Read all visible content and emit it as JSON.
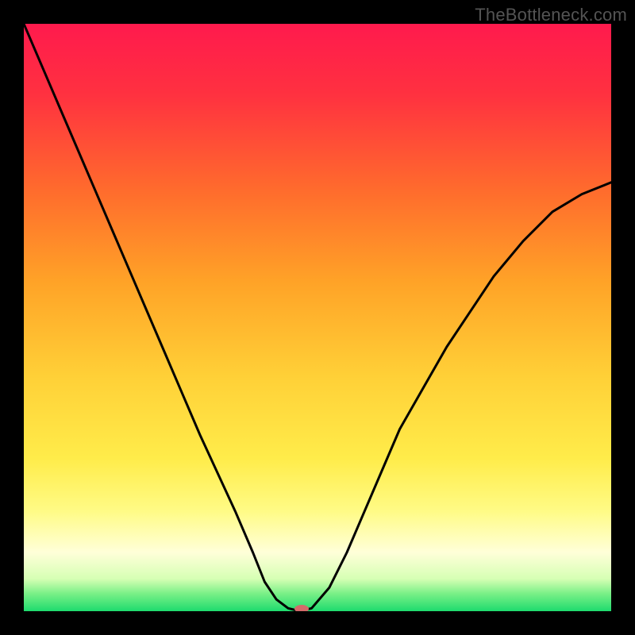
{
  "watermark": "TheBottleneck.com",
  "chart_data": {
    "type": "line",
    "title": "",
    "xlabel": "",
    "ylabel": "",
    "xlim": [
      0,
      100
    ],
    "ylim": [
      0,
      100
    ],
    "grid": false,
    "legend": false,
    "background": {
      "type": "vertical-gradient",
      "stops": [
        {
          "offset": 0.0,
          "color": "#ff1a4d"
        },
        {
          "offset": 0.12,
          "color": "#ff3140"
        },
        {
          "offset": 0.28,
          "color": "#ff6a2d"
        },
        {
          "offset": 0.44,
          "color": "#ffa327"
        },
        {
          "offset": 0.6,
          "color": "#ffd037"
        },
        {
          "offset": 0.74,
          "color": "#ffec4a"
        },
        {
          "offset": 0.83,
          "color": "#fffb86"
        },
        {
          "offset": 0.9,
          "color": "#ffffd9"
        },
        {
          "offset": 0.945,
          "color": "#d6ffb4"
        },
        {
          "offset": 0.97,
          "color": "#7af087"
        },
        {
          "offset": 1.0,
          "color": "#1edb6e"
        }
      ]
    },
    "series": [
      {
        "name": "bottleneck-curve",
        "color": "#000000",
        "stroke_width": 3,
        "x": [
          0,
          3,
          6,
          9,
          12,
          15,
          18,
          21,
          24,
          27,
          30,
          33,
          36,
          39,
          41,
          43,
          45,
          47,
          49,
          52,
          55,
          58,
          61,
          64,
          68,
          72,
          76,
          80,
          85,
          90,
          95,
          100
        ],
        "y": [
          100,
          93,
          86,
          79,
          72,
          65,
          58,
          51,
          44,
          37,
          30,
          23.5,
          17,
          10,
          5,
          2,
          0.5,
          0,
          0.5,
          4,
          10,
          17,
          24,
          31,
          38,
          45,
          51,
          57,
          63,
          68,
          71,
          73
        ]
      }
    ],
    "marker": {
      "name": "optimal-point",
      "x": 47.3,
      "y": 0,
      "color": "#d46a6a",
      "rx": 9,
      "ry": 5
    }
  }
}
